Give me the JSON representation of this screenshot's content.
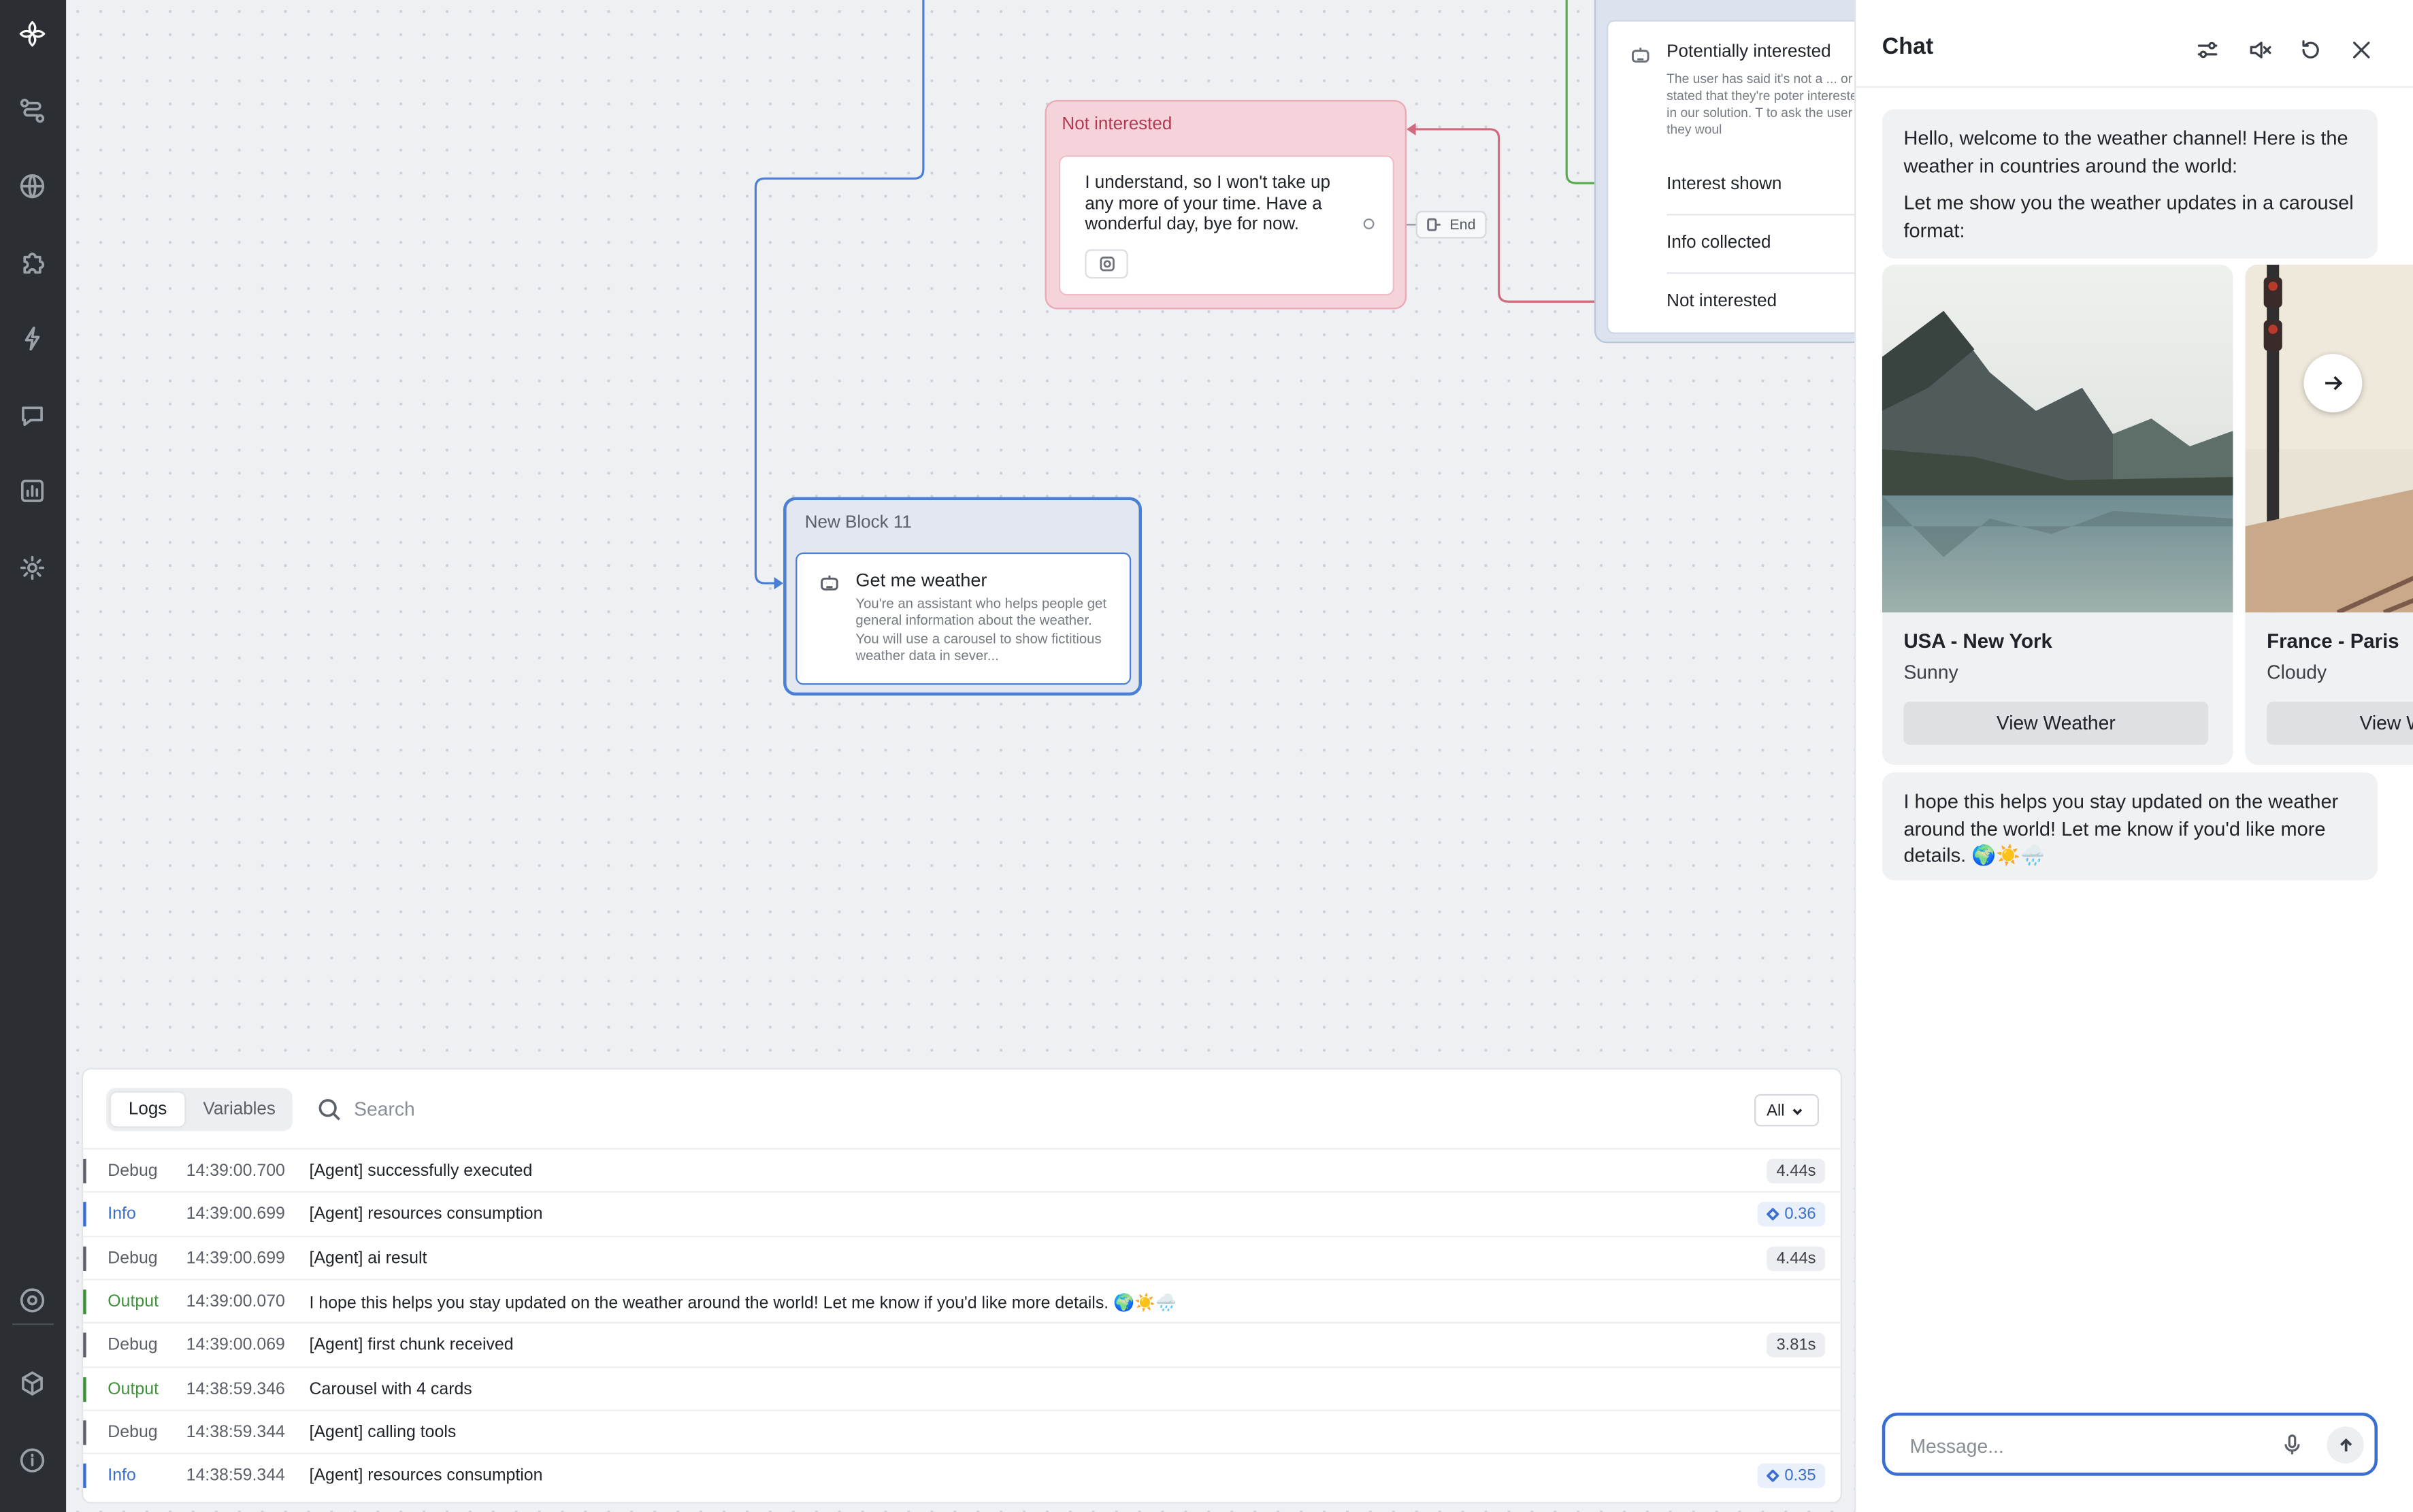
{
  "sidebar": {
    "icons": [
      "logo-icon",
      "flows-icon",
      "globe-icon",
      "puzzle-icon",
      "integrations-icon",
      "chat-icon",
      "analytics-icon",
      "settings-icon",
      "help-icon",
      "package-icon",
      "info-icon"
    ]
  },
  "canvas": {
    "not_interested_block": {
      "title": "Not interested",
      "message": "I understand, so I won't take up any more of your time. Have a wonderful day, bye for now.",
      "end_label": "End"
    },
    "potentially_interested_block": {
      "title": "Potentially interested",
      "description": "The user has said it's not a ... or stated that they're poter interested in our solution. T to ask the user if they woul",
      "routes": [
        "Interest shown",
        "Info collected",
        "Not interested"
      ]
    },
    "new_block": {
      "title": "New Block 11",
      "step_title": "Get me weather",
      "step_description": "You're an assistant who helps people get general information about the weather. You will use a carousel to show fictitious weather data in sever..."
    }
  },
  "logs": {
    "tabs": [
      "Logs",
      "Variables"
    ],
    "active_tab": "Logs",
    "search_placeholder": "Search",
    "filter_value": "All",
    "entries": [
      {
        "level": "Debug",
        "time": "14:39:00.700",
        "message": "[Agent] successfully executed",
        "badge": "4.44s"
      },
      {
        "level": "Info",
        "time": "14:39:00.699",
        "message": "[Agent] resources consumption",
        "badge": "0.36"
      },
      {
        "level": "Debug",
        "time": "14:39:00.699",
        "message": "[Agent] ai result",
        "badge": "4.44s"
      },
      {
        "level": "Output",
        "time": "14:39:00.070",
        "message": "I hope this helps you stay updated on the weather around the world! Let me know if you'd like more details. 🌍☀️🌧️",
        "badge": ""
      },
      {
        "level": "Debug",
        "time": "14:39:00.069",
        "message": "[Agent] first chunk received",
        "badge": "3.81s"
      },
      {
        "level": "Output",
        "time": "14:38:59.346",
        "message": "Carousel with 4 cards",
        "badge": ""
      },
      {
        "level": "Debug",
        "time": "14:38:59.344",
        "message": "[Agent] calling tools",
        "badge": ""
      },
      {
        "level": "Info",
        "time": "14:38:59.344",
        "message": "[Agent] resources consumption",
        "badge": "0.35"
      }
    ],
    "level_colors": {
      "Debug": "#5b6068",
      "Info": "#3a6fd2",
      "Output": "#3f8f3a"
    }
  },
  "chat": {
    "title": "Chat",
    "header_icons": [
      "settings-sliders-icon",
      "mute-icon",
      "reset-icon",
      "close-icon"
    ],
    "greeting_line1": "Hello, welcome to the weather channel! Here is the weather in countries around the world:",
    "greeting_line2": "Let me show you the weather updates in a carousel format:",
    "cards": [
      {
        "title": "USA - New York",
        "subtitle": "Sunny",
        "button": "View Weather"
      },
      {
        "title": "France - Paris",
        "subtitle": "Cloudy",
        "button": "View Weather"
      }
    ],
    "closing_message": "I hope this helps you stay updated on the weather around the world! Let me know if you'd like more details. 🌍☀️🌧️",
    "input_placeholder": "Message..."
  },
  "colors": {
    "accent": "#3a6fd2",
    "sidebar_bg": "#2b2e33",
    "not_interested_bg": "#f4d4da",
    "new_block_border": "#4a7fd6"
  }
}
